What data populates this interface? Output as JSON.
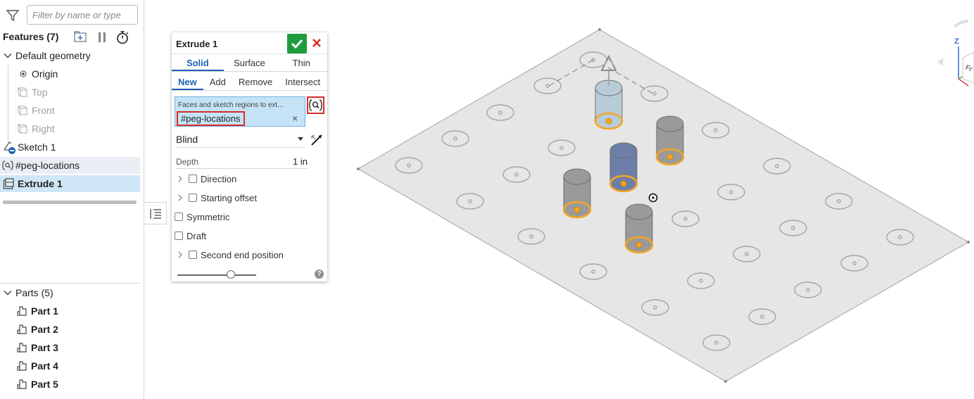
{
  "filter": {
    "placeholder": "Filter by name or type"
  },
  "features": {
    "title": "Features (7)",
    "default_geometry": "Default geometry",
    "origin": "Origin",
    "planes": [
      "Top",
      "Front",
      "Right"
    ],
    "sketch": "Sketch 1",
    "query": "#peg-locations",
    "extrude": "Extrude 1"
  },
  "parts": {
    "title": "Parts (5)",
    "items": [
      "Part 1",
      "Part 2",
      "Part 3",
      "Part 4",
      "Part 5"
    ]
  },
  "dialog": {
    "title": "Extrude 1",
    "tabs": [
      "Solid",
      "Surface",
      "Thin"
    ],
    "ops": [
      "New",
      "Add",
      "Remove",
      "Intersect"
    ],
    "selection_label": "Faces and sketch regions to ext...",
    "selection_value": "#peg-locations",
    "clear": "×",
    "end_type": "Blind",
    "depth_label": "Depth",
    "depth_value": "1 in",
    "direction": "Direction",
    "starting_offset": "Starting offset",
    "symmetric": "Symmetric",
    "draft": "Draft",
    "second_end": "Second end position",
    "help": "?"
  },
  "viewcube": {
    "axis_z": "Z",
    "face": "Fr"
  },
  "colors": {
    "accent": "#1d5fb6",
    "ok": "#1f9d3d",
    "cancel": "#d92b2b",
    "highlight": "#f5a623",
    "peg": "#9a9a9a",
    "peg_selected": "#6d7fa8",
    "peg_hover": "#b8ccd8"
  }
}
